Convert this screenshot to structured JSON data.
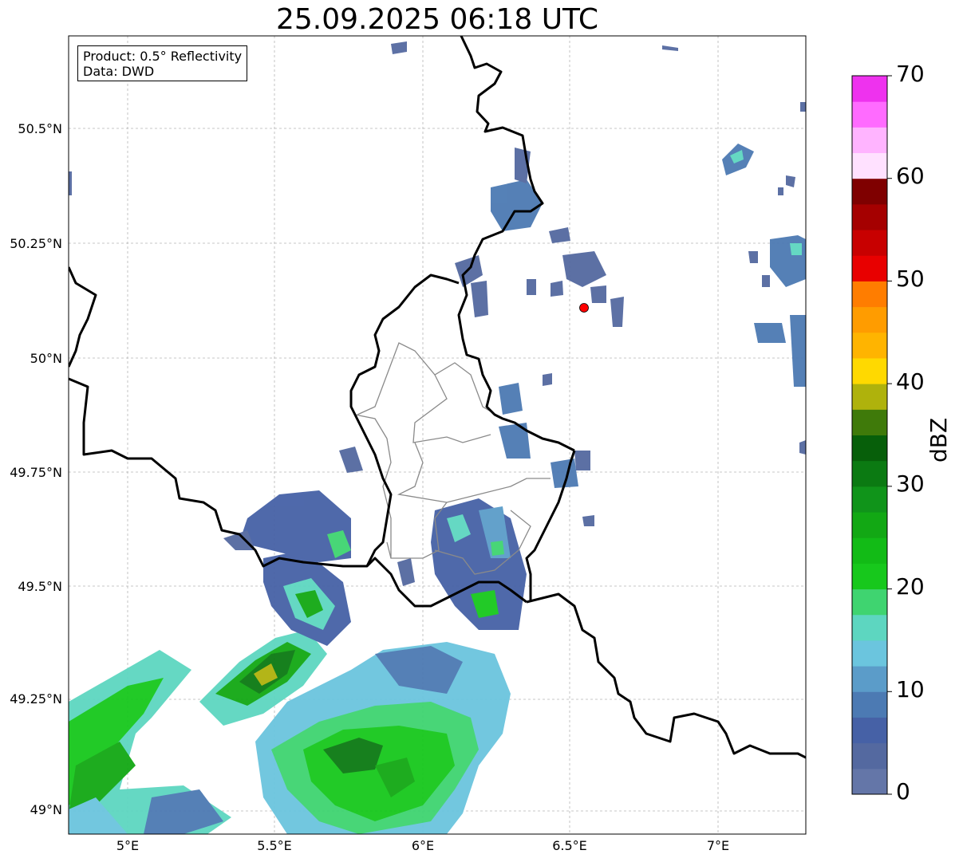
{
  "title": "25.09.2025 06:18 UTC",
  "infobox": {
    "product": "Product: 0.5° Reflectivity",
    "data": "Data: DWD"
  },
  "map": {
    "lon_range": [
      4.8,
      7.3
    ],
    "lat_range": [
      48.95,
      50.7
    ],
    "lon_ticks": [
      "5°E",
      "5.5°E",
      "6°E",
      "6.5°E",
      "7°E"
    ],
    "lat_ticks": [
      "49°N",
      "49.25°N",
      "49.5°N",
      "49.75°N",
      "50°N",
      "50.25°N",
      "50.5°N"
    ],
    "gridlines": true,
    "radar_site": {
      "lon": 6.55,
      "lat": 50.11,
      "color": "#ff0000"
    }
  },
  "colorbar": {
    "label": "dBZ",
    "ticks": [
      "0",
      "10",
      "20",
      "30",
      "40",
      "50",
      "60",
      "70"
    ],
    "range": [
      0,
      70
    ],
    "step": 2.5,
    "colors": [
      "#6476a8",
      "#5469a0",
      "#4661a6",
      "#4c7ab3",
      "#5b9cc9",
      "#6bc5de",
      "#5dd6c0",
      "#3fd470",
      "#17c81c",
      "#12bb16",
      "#12a814",
      "#10941a",
      "#0b7a12",
      "#075f0a",
      "#3f7a0a",
      "#afb20c",
      "#ffd900",
      "#ffb400",
      "#ff9c00",
      "#ff7d00",
      "#e80000",
      "#c80000",
      "#a50000",
      "#7f0000",
      "#ffe1ff",
      "#ffb4ff",
      "#ff6bff",
      "#ee32ee"
    ]
  }
}
